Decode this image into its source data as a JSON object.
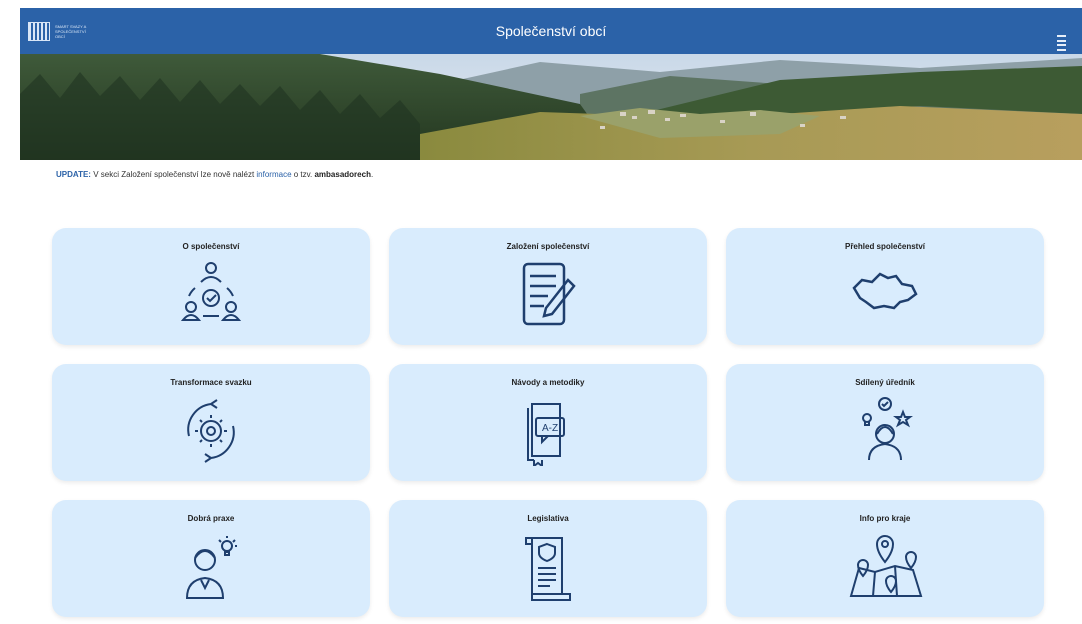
{
  "header": {
    "title": "Společenství obcí",
    "logo_text": "SMART SVAZY A SPOLEČENSTVÍ OBCÍ"
  },
  "notice": {
    "prefix": "UPDATE:",
    "text1": " V sekci Založení společenství lze nově nalézt ",
    "link": "informace",
    "text2": " o tzv. ",
    "bold": "ambasadorech",
    "end": "."
  },
  "cards": [
    {
      "label": "O společenství",
      "icon": "people-check-icon"
    },
    {
      "label": "Založení společenství",
      "icon": "document-pen-icon"
    },
    {
      "label": "Přehled společenství",
      "icon": "czech-map-outline-icon"
    },
    {
      "label": "Transformace svazku",
      "icon": "gear-cycle-icon"
    },
    {
      "label": "Návody a metodiky",
      "icon": "book-a-z-icon"
    },
    {
      "label": "Sdílený úředník",
      "icon": "person-ideas-icon"
    },
    {
      "label": "Dobrá praxe",
      "icon": "person-lightbulb-icon"
    },
    {
      "label": "Legislativa",
      "icon": "legal-scroll-icon"
    },
    {
      "label": "Info pro kraje",
      "icon": "map-pins-icon"
    }
  ],
  "colors": {
    "header": "#2b62a8",
    "card": "#d9ecfd",
    "icon": "#1f3f6e"
  }
}
